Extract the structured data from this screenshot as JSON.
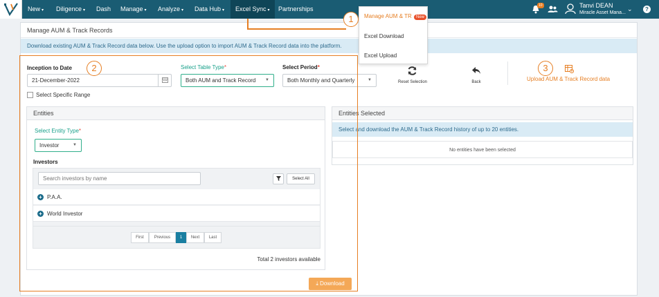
{
  "nav": {
    "items": [
      {
        "label": "New",
        "caret": true
      },
      {
        "label": "Diligence",
        "caret": true
      },
      {
        "label": "Dash",
        "caret": false
      },
      {
        "label": "Manage",
        "caret": true
      },
      {
        "label": "Analyze",
        "caret": true
      },
      {
        "label": "Data Hub",
        "caret": true
      },
      {
        "label": "Excel Sync",
        "caret": true
      },
      {
        "label": "Partnerships",
        "caret": false
      }
    ],
    "notification_count": "10",
    "user_name": "Tanvi DEAN",
    "user_org": "Miracle Asset Mana...",
    "help_icon": "?"
  },
  "dropdown": {
    "items": [
      {
        "label": "Manage AUM & TR",
        "badge": "New"
      },
      {
        "label": "Excel Download"
      },
      {
        "label": "Excel Upload"
      }
    ]
  },
  "annotations": [
    "1",
    "2",
    "3"
  ],
  "page": {
    "title": "Manage AUM & Track Records",
    "info": "Download existing AUM & Track Record data below. Use the upload option to import AUM & Track Record data into the platform."
  },
  "filters": {
    "inception_label": "Inception to Date",
    "inception_value": "21-December-2022",
    "specific_range_label": "Select Specific Range",
    "table_type_label": "Select Table Type",
    "table_type_value": "Both AUM and Track Record",
    "period_label": "Select Period",
    "period_value": "Both Monthly and Quarterly",
    "reset_label": "Reset Selection",
    "back_label": "Back",
    "upload_label": "Upload AUM & Track Record data"
  },
  "entities": {
    "title": "Entities",
    "entity_type_label": "Select Entity Type",
    "entity_type_value": "Investor",
    "investors_label": "Investors",
    "search_placeholder": "Search investors by name",
    "select_all_label": "Select All",
    "rows": [
      "P.A.A.",
      "World Investor"
    ],
    "pager": [
      "First",
      "Previous",
      "1",
      "Next",
      "Last"
    ],
    "total_text": "Total 2 investors available",
    "download_label": "Download"
  },
  "selected": {
    "title": "Entities Selected",
    "info": "Select and download the AUM & Track Record history of up to 20 entities.",
    "empty_text": "No entities have been selected"
  },
  "colors": {
    "nav_bg": "#1a5c73",
    "accent_orange": "#e67e22",
    "accent_teal": "#18a08a",
    "info_bg": "#d9ebf5"
  }
}
